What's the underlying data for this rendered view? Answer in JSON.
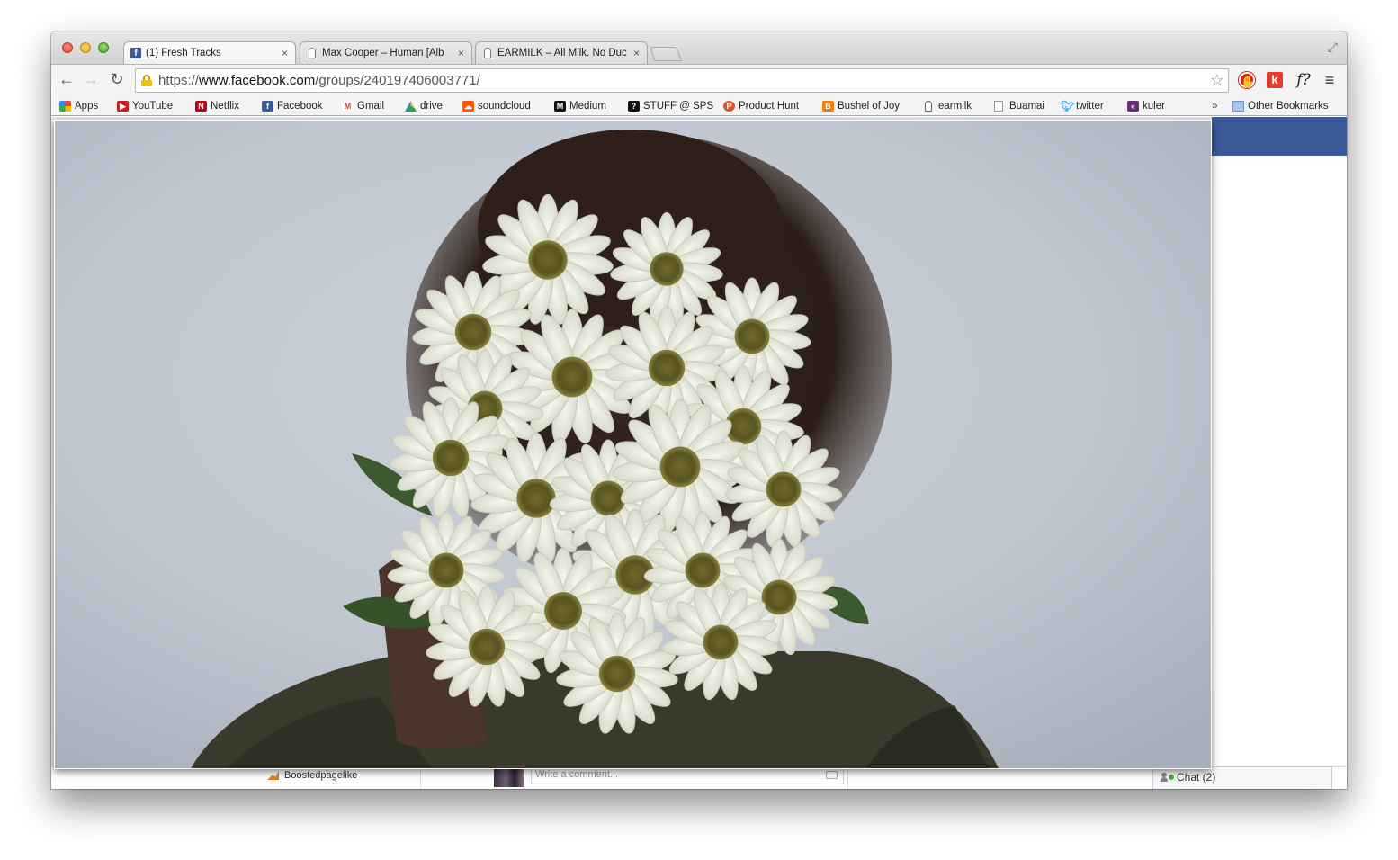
{
  "browser": {
    "tabs": [
      {
        "title": "(1) Fresh Tracks",
        "favicon": "facebook-icon",
        "active": true
      },
      {
        "title": "Max Cooper – Human [Alb",
        "favicon": "earmilk-icon",
        "active": false
      },
      {
        "title": "EARMILK – All Milk. No Duc",
        "favicon": "earmilk-icon",
        "active": false
      }
    ],
    "close_glyph": "×",
    "url_scheme": "https://",
    "url_domain": "www.facebook.com",
    "url_path": "/groups/240197406003771/",
    "extensions": {
      "font_label": "f?",
      "k_label": "k"
    }
  },
  "bookmarks": {
    "items": [
      {
        "label": "Apps",
        "icon": "apps-grid-icon",
        "color": "#4285f4"
      },
      {
        "label": "YouTube",
        "icon": "youtube-icon",
        "color": "#cc181e"
      },
      {
        "label": "Netflix",
        "icon": "netflix-icon",
        "color": "#b20710"
      },
      {
        "label": "Facebook",
        "icon": "facebook-icon",
        "color": "#3b5998"
      },
      {
        "label": "Gmail",
        "icon": "gmail-icon",
        "color": "#d14836"
      },
      {
        "label": "drive",
        "icon": "drive-icon",
        "color": "#1fa463"
      },
      {
        "label": "soundcloud",
        "icon": "soundcloud-icon",
        "color": "#ff5500"
      },
      {
        "label": "Medium",
        "icon": "medium-icon",
        "color": "#111111"
      },
      {
        "label": "STUFF @ SPS",
        "icon": "stuff-icon",
        "color": "#111111"
      },
      {
        "label": "Product Hunt",
        "icon": "product-hunt-icon",
        "color": "#da552f"
      },
      {
        "label": "Bushel of Joy",
        "icon": "blogger-icon",
        "color": "#f57d00"
      },
      {
        "label": "earmilk",
        "icon": "earmilk-icon",
        "color": "#ffffff"
      },
      {
        "label": "Buamai",
        "icon": "page-icon",
        "color": "#ffffff"
      },
      {
        "label": "twitter",
        "icon": "twitter-icon",
        "color": "#1da1f2"
      },
      {
        "label": "kuler",
        "icon": "kuler-icon",
        "color": "#6b2c7a"
      }
    ],
    "overflow_glyph": "»",
    "other_bookmarks": "Other Bookmarks"
  },
  "facebook": {
    "brand_color": "#3b5998",
    "sidebar_link": "Boostedpagelike",
    "comment_placeholder": "Write a comment...",
    "chat_label": "Chat (2)"
  }
}
